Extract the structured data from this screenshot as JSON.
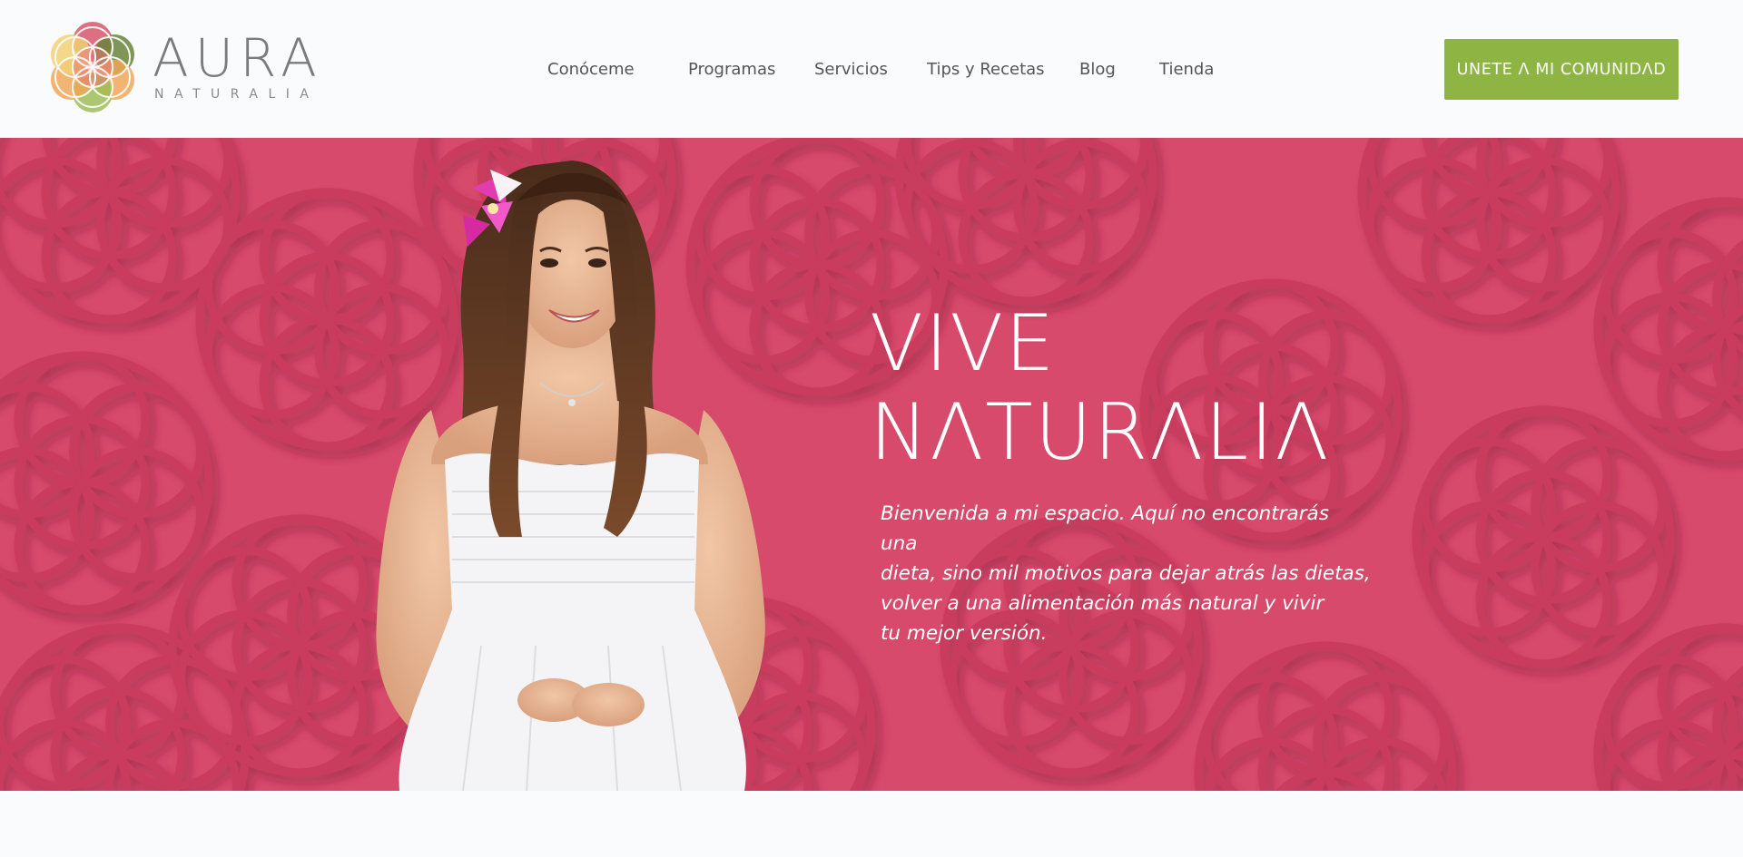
{
  "brand": {
    "name": "AURA",
    "tagline": "NATURALIA",
    "logo_colors": [
      "#d4495f",
      "#f0a04b",
      "#f2cd68",
      "#97b94a",
      "#5e7a2b"
    ]
  },
  "nav": {
    "items": [
      {
        "label": "Conóceme"
      },
      {
        "label": "Programas"
      },
      {
        "label": "Servicios"
      },
      {
        "label": "Tips y Recetas"
      },
      {
        "label": "Blog"
      },
      {
        "label": "Tienda"
      }
    ]
  },
  "cta": {
    "label": "UNETE Λ MI COMUNIDΛD",
    "color": "#8eb543"
  },
  "hero": {
    "background_color": "#d74a6c",
    "title": "VIVE\nNΛTURΛLIΛ",
    "text": "Bienvenida a mi espacio. Aquí no encontrarás una\ndieta, sino mil motivos para dejar atrás las dietas,\nvolver a una alimentación más natural y vivir\ntu mejor versión.",
    "image": "woman-portrait-white-dress-pink-flower"
  }
}
